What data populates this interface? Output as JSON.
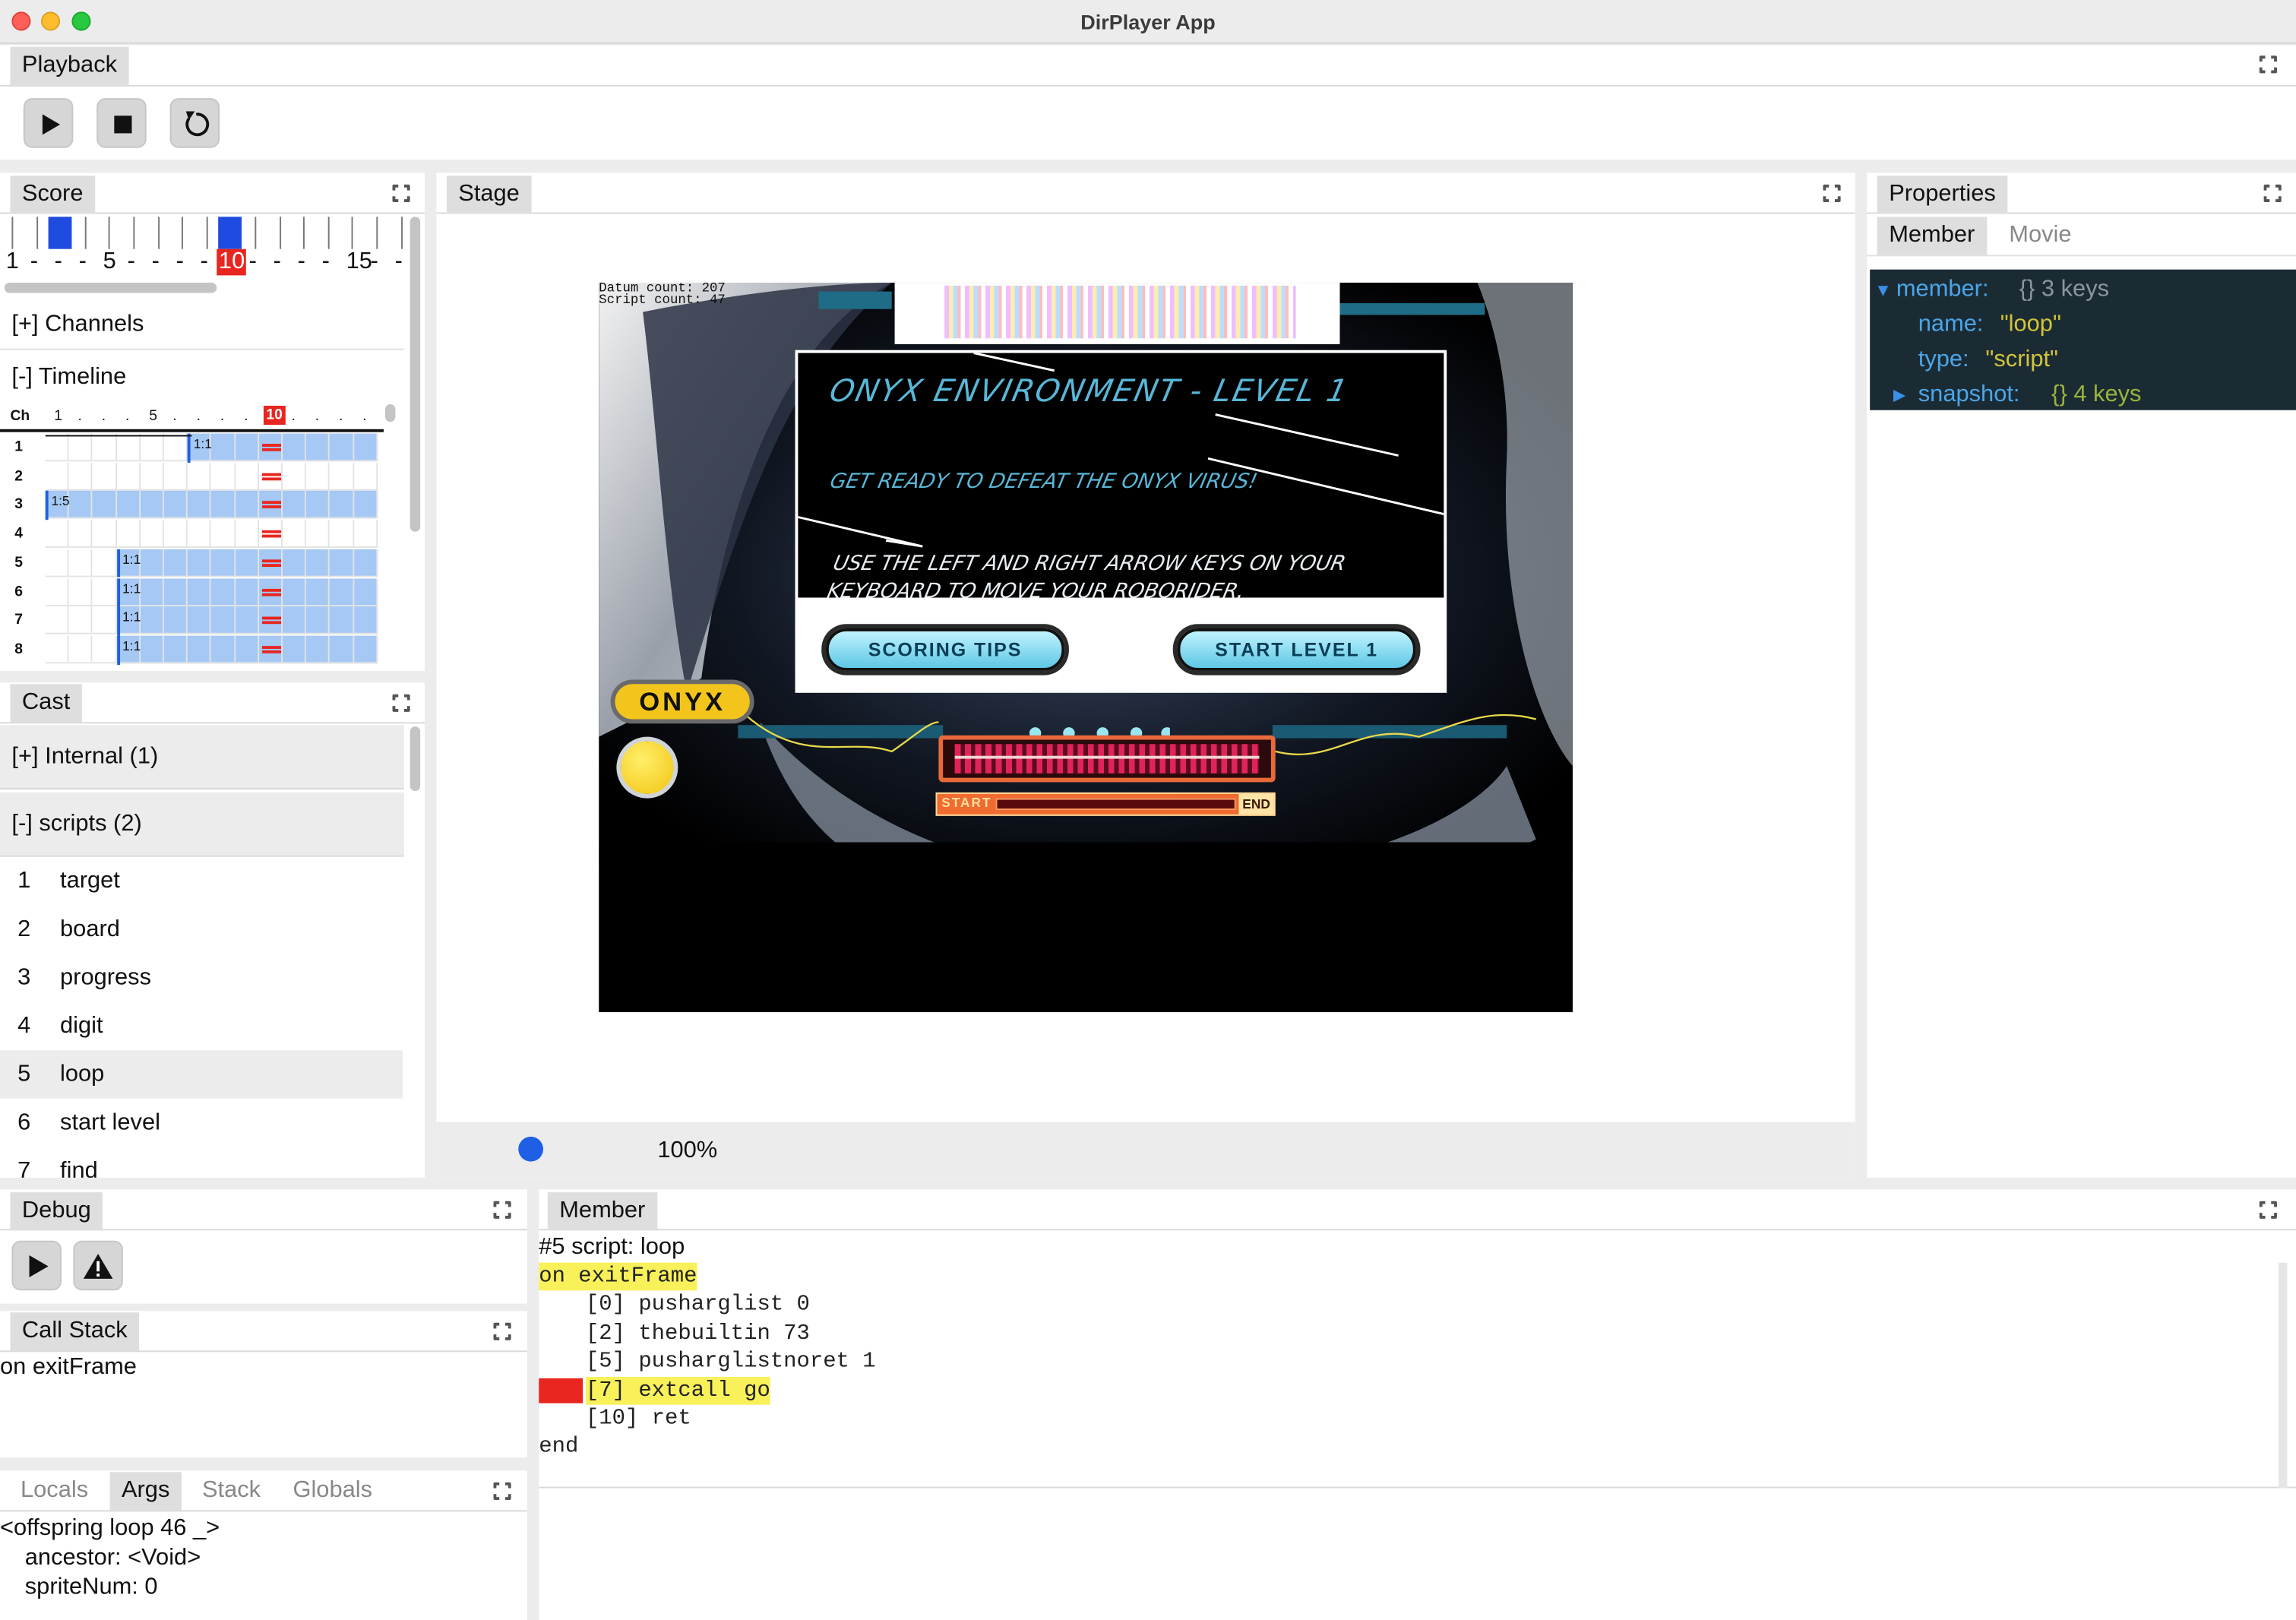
{
  "window": {
    "title": "DirPlayer App"
  },
  "playback": {
    "tab": "Playback"
  },
  "score": {
    "tab": "Score",
    "ruler": [
      {
        "text": "1"
      },
      {
        "text": "-"
      },
      {
        "text": "-"
      },
      {
        "text": "-"
      },
      {
        "text": "5"
      },
      {
        "text": "-"
      },
      {
        "text": "-"
      },
      {
        "text": "-"
      },
      {
        "text": "-"
      },
      {
        "text": "10"
      },
      {
        "text": "-"
      },
      {
        "text": "-"
      },
      {
        "text": "-"
      },
      {
        "text": "-"
      },
      {
        "text": "15"
      },
      {
        "text": "-"
      },
      {
        "text": "-"
      }
    ],
    "channels_label": "[+] Channels",
    "timeline_label": "[-] Timeline",
    "grid_header": {
      "ch": "Ch",
      "marks": [
        "1",
        ".",
        ".",
        ".",
        "5",
        ".",
        ".",
        ".",
        ".",
        "10",
        ".",
        ".",
        ".",
        ".",
        "."
      ]
    },
    "rows": [
      {
        "ch": "1",
        "label": "1:1"
      },
      {
        "ch": "2",
        "label": ""
      },
      {
        "ch": "3",
        "label": "1:5"
      },
      {
        "ch": "4",
        "label": ""
      },
      {
        "ch": "5",
        "label": "1:1"
      },
      {
        "ch": "6",
        "label": "1:1"
      },
      {
        "ch": "7",
        "label": "1:1"
      },
      {
        "ch": "8",
        "label": "1:1"
      }
    ]
  },
  "cast": {
    "tab": "Cast",
    "internal": "[+] Internal (1)",
    "scripts": "[-] scripts (2)",
    "items": [
      {
        "num": "1",
        "name": "target"
      },
      {
        "num": "2",
        "name": "board"
      },
      {
        "num": "3",
        "name": "progress"
      },
      {
        "num": "4",
        "name": "digit"
      },
      {
        "num": "5",
        "name": "loop"
      },
      {
        "num": "6",
        "name": "start level"
      },
      {
        "num": "7",
        "name": "find"
      }
    ]
  },
  "stage": {
    "tab": "Stage",
    "zoom": "100%",
    "game": {
      "debug_line1": "Datum count: 207",
      "debug_line2": "Script count: 47",
      "heading": "ONYX ENVIRONMENT - LEVEL 1",
      "line1": "GET READY TO DEFEAT THE ONYX VIRUS!",
      "line2": "USE THE LEFT AND RIGHT ARROW KEYS ON YOUR KEYBOARD TO MOVE YOUR ROBORIDER.",
      "btn_tips": "SCORING TIPS",
      "btn_start": "START LEVEL 1",
      "logo": "ONYX",
      "start_label": "START",
      "end_label": "END"
    }
  },
  "properties": {
    "tab": "Properties",
    "subtabs": [
      "Member",
      "Movie"
    ],
    "tree": {
      "member_key": "member:",
      "member_meta": "{} 3 keys",
      "name_key": "name:",
      "name_val": "\"loop\"",
      "type_key": "type:",
      "type_val": "\"script\"",
      "snapshot_key": "snapshot:",
      "snapshot_meta": "{} 4 keys"
    }
  },
  "debug": {
    "tab": "Debug"
  },
  "callstack": {
    "tab": "Call Stack",
    "entries": [
      "on exitFrame"
    ]
  },
  "vars": {
    "tabs": [
      "Locals",
      "Args",
      "Stack",
      "Globals"
    ],
    "lines": [
      "<offspring loop 46 _>",
      "ancestor: <Void>",
      "spriteNum: 0"
    ]
  },
  "member": {
    "tab": "Member",
    "header": "#5 script: loop",
    "code": [
      {
        "text": "on exitFrame"
      },
      {
        "text": "[0] pusharglist 0"
      },
      {
        "text": "[2] thebuiltin 73"
      },
      {
        "text": "[5] pusharglistnoret 1"
      },
      {
        "text": "[7] extcall go"
      },
      {
        "text": "[10] ret"
      },
      {
        "text": "end"
      }
    ]
  },
  "colors": {
    "accent": "#1f5fe6",
    "highlight": "#f8f15a",
    "breakpoint": "#e8261f",
    "tree_bg": "#1b2b34"
  }
}
